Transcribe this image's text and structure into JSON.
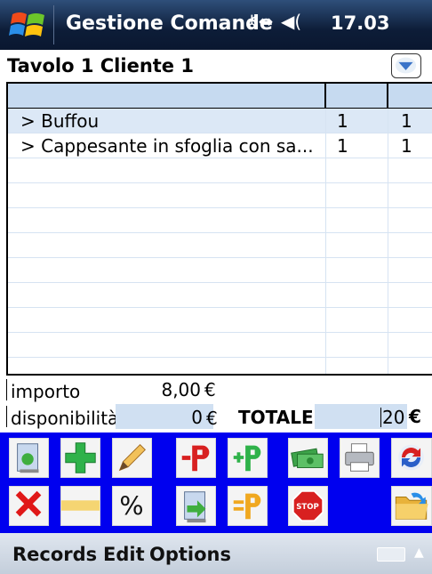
{
  "status_bar": {
    "app_title": "Gestione Comande",
    "time": "17.03"
  },
  "header": {
    "table_label": "Tavolo 1 Cliente 1"
  },
  "order_grid": {
    "rows": [
      {
        "item": "> Buffou",
        "qty": "1",
        "col3": "1"
      },
      {
        "item": "> Cappesante in sfoglia con sa...",
        "qty": "1",
        "col3": "1"
      }
    ]
  },
  "summary": {
    "importo_label": "importo",
    "importo_value": "8,00",
    "currency": "€",
    "disponibilita_label": "disponibilità",
    "disponibilita_value": "0",
    "totale_label": "TOTALE",
    "totale_value": "20"
  },
  "toolbar": {
    "row1": [
      "add-dish-icon",
      "plus-icon",
      "pencil-icon",
      "minus-p-icon",
      "plus-p-icon",
      "money-icon",
      "printer-icon",
      "sync-icon"
    ],
    "row2": [
      "delete-icon",
      "blank-icon",
      "percent-icon",
      "transfer-dish-icon",
      "equals-p-icon",
      "blank-icon",
      "stop-icon",
      "blank-icon",
      "folder-icon"
    ]
  },
  "menu_bar": {
    "records": "Records",
    "edit": "Edit",
    "options": "Options"
  },
  "colors": {
    "toolbar_bg": "#0000ef",
    "grid_selection": "#dce8f6",
    "titlebar": "#0d1d38"
  }
}
